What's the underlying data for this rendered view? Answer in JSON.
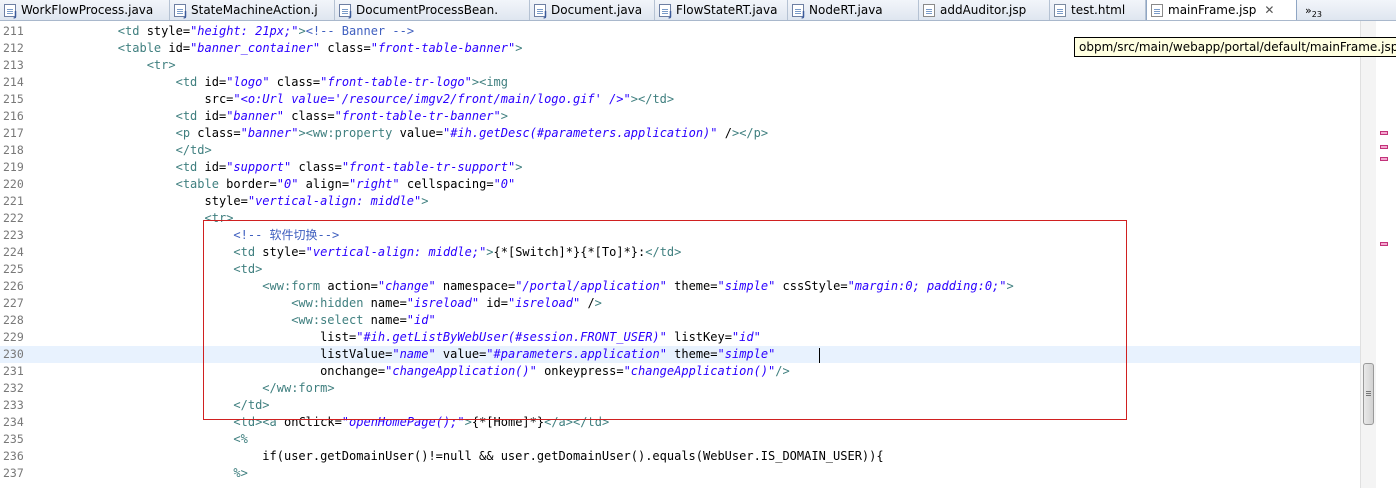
{
  "tabs": [
    {
      "label": "WorkFlowProcess.java",
      "icon": "java-file-icon",
      "active": false
    },
    {
      "label": "StateMachineAction.j",
      "icon": "java-file-icon",
      "active": false
    },
    {
      "label": "DocumentProcessBean.",
      "icon": "java-file-icon",
      "active": false
    },
    {
      "label": "Document.java",
      "icon": "java-file-icon",
      "active": false
    },
    {
      "label": "FlowStateRT.java",
      "icon": "java-file-icon",
      "active": false
    },
    {
      "label": "NodeRT.java",
      "icon": "java-file-icon",
      "active": false
    },
    {
      "label": "addAuditor.jsp",
      "icon": "jsp-file-icon",
      "active": false
    },
    {
      "label": "test.html",
      "icon": "html-file-icon",
      "active": false
    },
    {
      "label": "mainFrame.jsp",
      "icon": "jsp-file-icon",
      "active": true,
      "close": "✕"
    }
  ],
  "overflow": {
    "glyph": "»",
    "count": "23"
  },
  "tooltip": "obpm/src/main/webapp/portal/default/mainFrame.jsp",
  "current_line": "230",
  "lines": [
    {
      "n": "211",
      "t": "        <td style=\"height: 21px;\"><!-- Banner -->"
    },
    {
      "n": "212",
      "t": "        <table id=\"banner_container\" class=\"front-table-banner\">"
    },
    {
      "n": "213",
      "t": "            <tr>"
    },
    {
      "n": "214",
      "t": "                <td id=\"logo\" class=\"front-table-tr-logo\"><img"
    },
    {
      "n": "215",
      "t": "                    src=\"<o:Url value='/resource/imgv2/front/main/logo.gif' />\"></td>"
    },
    {
      "n": "216",
      "t": "                <td id=\"banner\" class=\"front-table-tr-banner\">"
    },
    {
      "n": "217",
      "t": "                <p class=\"banner\"><ww:property value=\"#ih.getDesc(#parameters.application)\" /></p>"
    },
    {
      "n": "218",
      "t": "                </td>"
    },
    {
      "n": "219",
      "t": "                <td id=\"support\" class=\"front-table-tr-support\">"
    },
    {
      "n": "220",
      "t": "                <table border=\"0\" align=\"right\" cellspacing=\"0\""
    },
    {
      "n": "221",
      "t": "                    style=\"vertical-align: middle\">"
    },
    {
      "n": "222",
      "t": "                    <tr>"
    },
    {
      "n": "223",
      "t": "                        <!-- 软件切换-->"
    },
    {
      "n": "224",
      "t": "                        <td style=\"vertical-align: middle;\">{*[Switch]*}{*[To]*}:</td>"
    },
    {
      "n": "225",
      "t": "                        <td>"
    },
    {
      "n": "226",
      "t": "                            <ww:form action=\"change\" namespace=\"/portal/application\" theme=\"simple\" cssStyle=\"margin:0; padding:0;\">"
    },
    {
      "n": "227",
      "t": "                                <ww:hidden name=\"isreload\" id=\"isreload\" />"
    },
    {
      "n": "228",
      "t": "                                <ww:select name=\"id\""
    },
    {
      "n": "229",
      "t": "                                    list=\"#ih.getListByWebUser(#session.FRONT_USER)\" listKey=\"id\""
    },
    {
      "n": "230",
      "t": "                                    listValue=\"name\" value=\"#parameters.application\" theme=\"simple\""
    },
    {
      "n": "231",
      "t": "                                    onchange=\"changeApplication()\" onkeypress=\"changeApplication()\"/>"
    },
    {
      "n": "232",
      "t": "                            </ww:form>"
    },
    {
      "n": "233",
      "t": "                        </td>"
    },
    {
      "n": "234",
      "t": "                        <td><a onClick=\"openHomePage();\">{*[Home]*}</a></td>"
    },
    {
      "n": "235",
      "t": "                        <%"
    },
    {
      "n": "236",
      "t": "                            if(user.getDomainUser()!=null && user.getDomainUser().equals(WebUser.IS_DOMAIN_USER)){"
    },
    {
      "n": "237",
      "t": "                        %>"
    }
  ],
  "colors": {
    "tag": "#3f7f7f",
    "attribute": "#7f007f",
    "value": "#2a00ff",
    "comment": "#3f5fbf",
    "current_line": "#e8f2fe",
    "highlight_box": "#d02020",
    "tooltip_bg": "#ffffe1"
  }
}
